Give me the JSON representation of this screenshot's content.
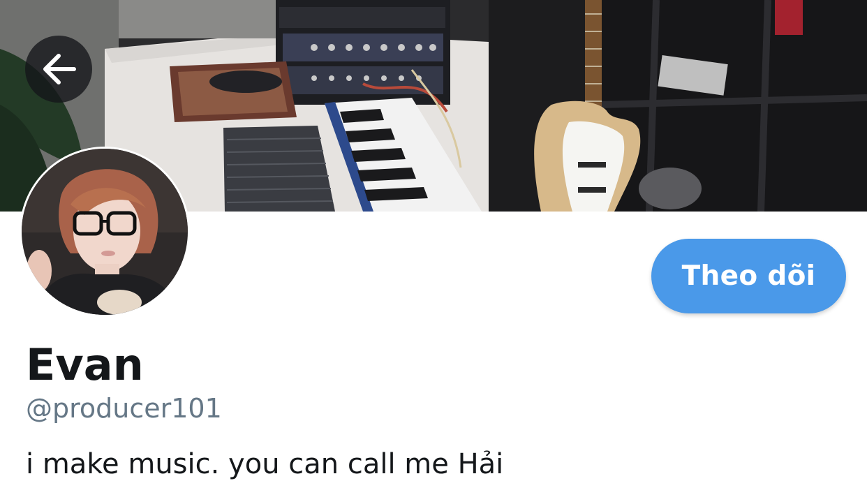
{
  "header": {
    "cover_image": "studio-desk-photo",
    "back_icon": "arrow-left-icon"
  },
  "profile": {
    "avatar_image": "profile-photo",
    "display_name": "Evan",
    "handle": "@producer101",
    "bio": "i make music. you can call me Hải"
  },
  "actions": {
    "follow_label": "Theo dõi"
  },
  "colors": {
    "accent": "#4a99e9",
    "name_text": "#14171a",
    "handle_text": "#657786"
  }
}
